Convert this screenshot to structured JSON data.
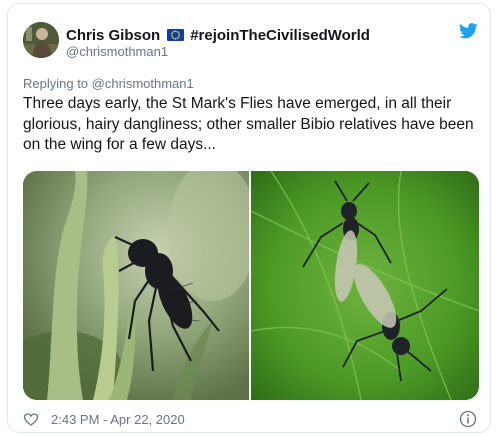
{
  "tweet": {
    "author_name": "Chris Gibson",
    "flag_icon": "eu-flag-icon",
    "hashtag": "#rejoinTheCivilisedWorld",
    "handle": "@chrismothman1",
    "reply_prefix": "Replying to",
    "reply_to": "@chrismothman1",
    "text": "Three days early, the St Mark's Flies have emerged, in all their glorious, hairy dangliness; other smaller Bibio relatives have been on the wing for a few days...",
    "timestamp": "2:43 PM - Apr 22, 2020"
  },
  "icons": {
    "brand": "twitter-bird-icon",
    "like": "heart-icon",
    "info": "info-icon"
  },
  "colors": {
    "text": "#14171a",
    "secondary": "#657786",
    "twitter_blue": "#1da1f2",
    "border": "#e1e8ed",
    "eu_blue": "#0d3fa6",
    "eu_star": "#ffdd00"
  }
}
